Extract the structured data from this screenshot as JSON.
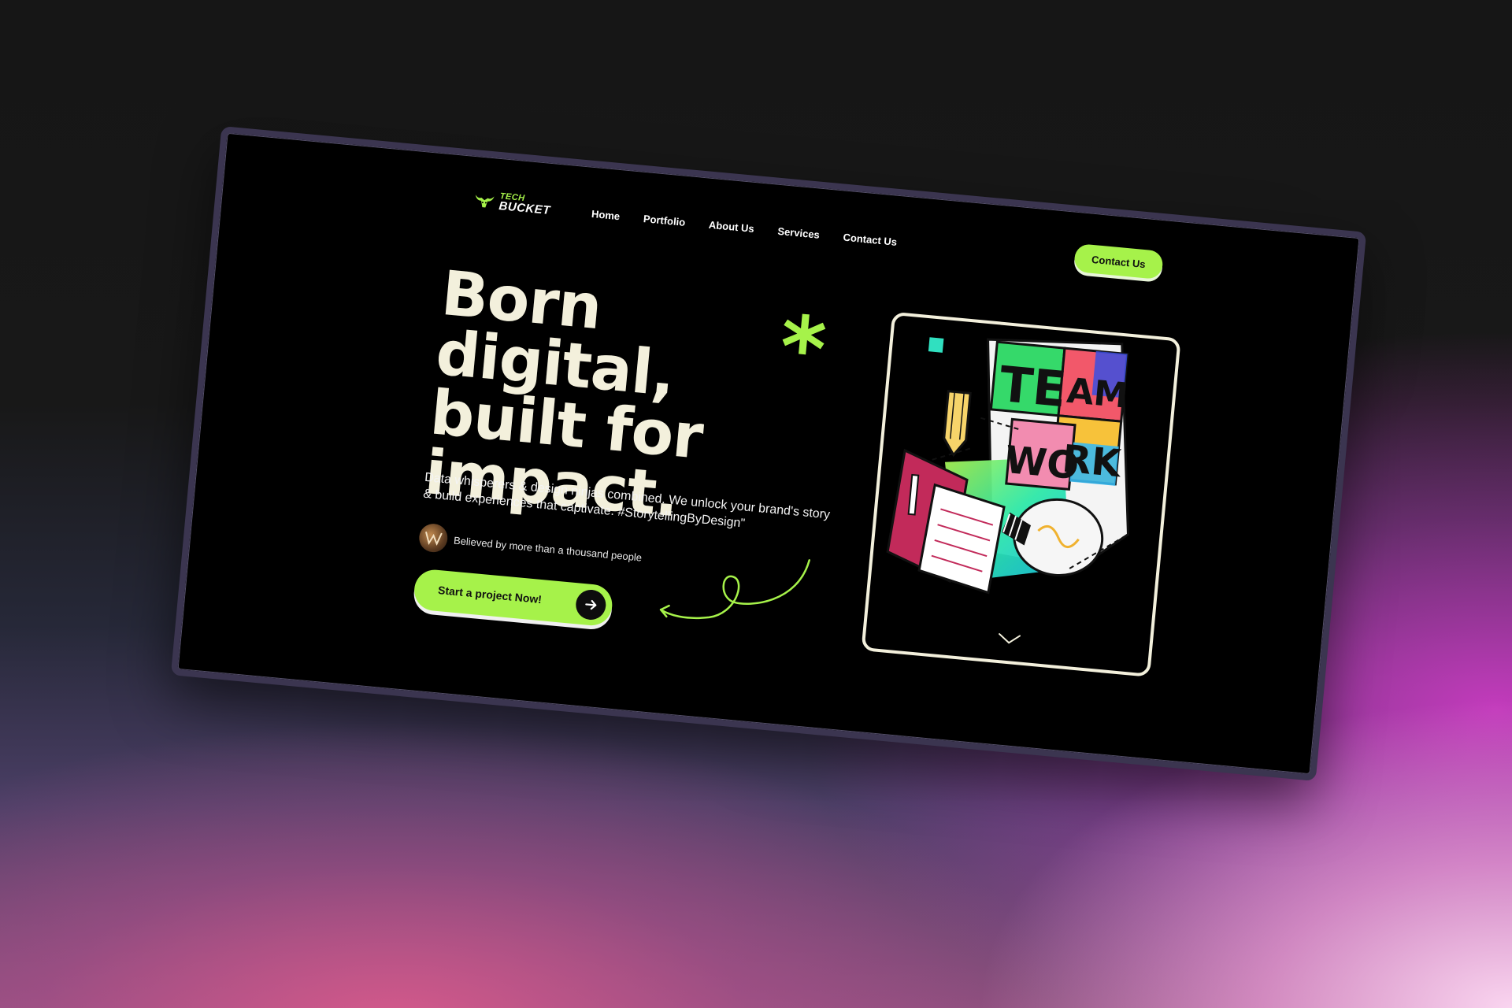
{
  "brand": {
    "logo_top": "TECH",
    "logo_bottom": "BUCKET",
    "accent_color": "#a6f24a",
    "cream_color": "#f3f0dc"
  },
  "nav": {
    "items": [
      {
        "label": "Home"
      },
      {
        "label": "Portfolio"
      },
      {
        "label": "About Us"
      },
      {
        "label": "Services"
      },
      {
        "label": "Contact Us"
      }
    ],
    "cta_label": "Contact Us"
  },
  "hero": {
    "title_line1": "Born digital,",
    "title_line2": "built for",
    "title_line3": "impact.",
    "asterisk": "*",
    "description": "Data whisperers & design ninjas combined. We unlock your brand's story & build experiences that captivate. #StorytellingByDesign\"",
    "social_proof": "Believed by more than a thousand people",
    "start_button": "Start a project Now!"
  },
  "illustration": {
    "word_top_left": "TE",
    "word_top_right": "AM",
    "word_bottom_left": "WO",
    "word_bottom_right": "RK",
    "icons": [
      "puzzle-piece-icon",
      "pencil-icon",
      "notebook-icon",
      "light-bulb-icon"
    ]
  }
}
